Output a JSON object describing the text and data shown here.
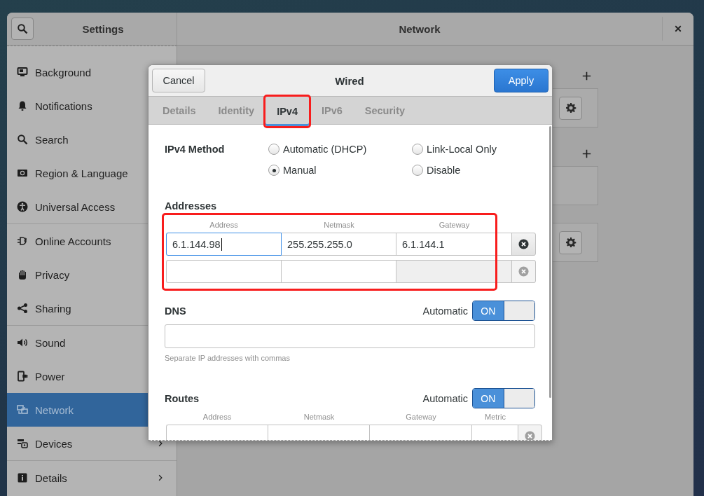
{
  "window": {
    "title": "Settings",
    "panel_title": "Network"
  },
  "sidebar": {
    "groups": [
      {
        "items": [
          {
            "label": "Background",
            "selected": false
          },
          {
            "label": "Notifications",
            "selected": false
          },
          {
            "label": "Search",
            "selected": false
          },
          {
            "label": "Region & Language",
            "selected": false
          },
          {
            "label": "Universal Access",
            "selected": false
          }
        ]
      },
      {
        "items": [
          {
            "label": "Online Accounts",
            "selected": false
          },
          {
            "label": "Privacy",
            "selected": false
          },
          {
            "label": "Sharing",
            "selected": false
          }
        ]
      },
      {
        "items": [
          {
            "label": "Sound",
            "selected": false
          },
          {
            "label": "Power",
            "selected": false
          },
          {
            "label": "Network",
            "selected": true
          },
          {
            "label": "Devices",
            "selected": false,
            "has_submenu": true
          }
        ]
      },
      {
        "items": [
          {
            "label": "Details",
            "selected": false,
            "has_submenu": true
          }
        ]
      }
    ]
  },
  "network_panel": {
    "sections": [
      {
        "cards": [
          {
            "has_settings": true
          }
        ]
      },
      {
        "cards": [
          {
            "has_settings": false
          },
          {
            "has_settings": true
          }
        ]
      }
    ]
  },
  "dialog": {
    "title": "Wired",
    "cancel": {
      "label": "Cancel"
    },
    "apply": {
      "label": "Apply"
    },
    "tabs": [
      {
        "label": "Details",
        "selected": false,
        "highlighted": false
      },
      {
        "label": "Identity",
        "selected": false,
        "highlighted": false
      },
      {
        "label": "IPv4",
        "selected": true,
        "highlighted": true
      },
      {
        "label": "IPv6",
        "selected": false,
        "highlighted": false
      },
      {
        "label": "Security",
        "selected": false,
        "highlighted": false
      }
    ],
    "ipv4_method": {
      "label": "IPv4 Method",
      "options": [
        {
          "label": "Automatic (DHCP)",
          "selected": false
        },
        {
          "label": "Link-Local Only",
          "selected": false
        },
        {
          "label": "Manual",
          "selected": true
        },
        {
          "label": "Disable",
          "selected": false
        }
      ]
    },
    "addresses": {
      "title": "Addresses",
      "highlighted": true,
      "columns": [
        "Address",
        "Netmask",
        "Gateway"
      ],
      "rows": [
        {
          "cells": [
            {
              "value": "6.1.144.98",
              "focused": true,
              "disabled": false
            },
            {
              "value": "255.255.255.0",
              "focused": false,
              "disabled": false
            },
            {
              "value": "6.1.144.1",
              "focused": false,
              "disabled": false
            }
          ],
          "removable": true
        },
        {
          "cells": [
            {
              "focused": false,
              "disabled": false
            },
            {
              "focused": false,
              "disabled": false
            },
            {
              "focused": false,
              "disabled": true
            }
          ],
          "removable": false
        }
      ]
    },
    "dns": {
      "title": "DNS",
      "automatic_label": "Automatic",
      "switch": {
        "on": true,
        "label": "ON"
      },
      "hint": "Separate IP addresses with commas"
    },
    "routes": {
      "title": "Routes",
      "automatic_label": "Automatic",
      "switch": {
        "on": true,
        "label": "ON"
      },
      "columns": [
        "Address",
        "Netmask",
        "Gateway",
        "Metric"
      ],
      "rows": [
        {
          "cells": [
            {
              "focused": false,
              "disabled": false
            },
            {
              "focused": false,
              "disabled": false
            },
            {
              "focused": false,
              "disabled": false
            },
            {
              "focused": false,
              "disabled": false
            }
          ],
          "removable": false
        }
      ]
    }
  }
}
